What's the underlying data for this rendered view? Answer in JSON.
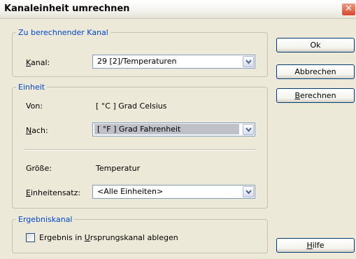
{
  "window": {
    "title": "Kanaleinheit umrechnen",
    "close_glyph": "✕"
  },
  "group_kanal": {
    "legend": "Zu berechnender Kanal",
    "kanal_label_underlined": "K",
    "kanal_label_rest": "anal:",
    "kanal_value": "29 [2]/Temperaturen"
  },
  "group_einheit": {
    "legend": "Einheit",
    "von_label": "Von:",
    "von_value": "[ °C ]  Grad Celsius",
    "nach_label_underlined": "N",
    "nach_label_rest": "ach:",
    "nach_value": "[ °F ] Grad Fahrenheit",
    "groesse_label": "Größe:",
    "groesse_value": "Temperatur",
    "satz_label_underlined": "E",
    "satz_label_rest": "inheitensatz:",
    "satz_value": "<Alle Einheiten>"
  },
  "group_ergebnis": {
    "legend": "Ergebniskanal",
    "checkbox_label_pre": "Ergebnis in ",
    "checkbox_label_underlined": "U",
    "checkbox_label_post": "rsprungskanal ablegen",
    "checkbox_checked": false
  },
  "buttons": {
    "ok": "Ok",
    "abbrechen": "Abbrechen",
    "berechnen_underlined": "B",
    "berechnen_rest": "erechnen",
    "hilfe_underlined": "H",
    "hilfe_rest": "ilfe"
  },
  "icons": {
    "dropdown": "chevron-down-icon",
    "close": "close-icon"
  },
  "colors": {
    "dialog_bg": "#ECE9D8",
    "legend_text": "#0046D5",
    "close_button": "#D9452A",
    "selected_item_bg": "#C0C0C8"
  }
}
